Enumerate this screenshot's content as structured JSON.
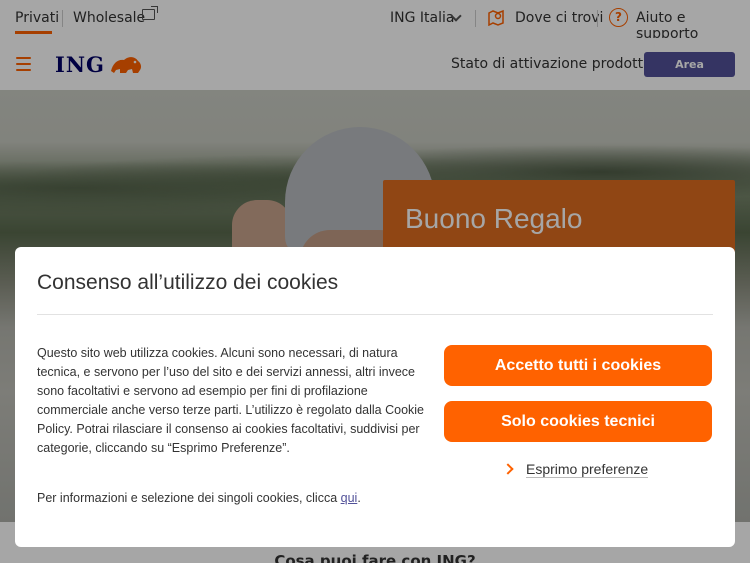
{
  "topbar": {
    "privati": "Privati",
    "wholesale": "Wholesale",
    "ing_italia": "ING Italia",
    "dove_ci_trovi": "Dove ci trovi",
    "help_glyph": "?",
    "aiuto": "Aiuto e supporto"
  },
  "header": {
    "logo": "ING",
    "stato": "Stato di attivazione prodotti",
    "area_riservata": "Area Riservata"
  },
  "hero": {
    "promo_title": "Buono Regalo"
  },
  "below": {
    "text": "Cosa puoi fare con ING?"
  },
  "cookie_modal": {
    "title": "Consenso all’utilizzo dei cookies",
    "body": "Questo sito web utilizza cookies. Alcuni sono necessari, di natura tecnica, e servono per l’uso del sito e dei servizi annessi, altri invece sono facoltativi e servono ad esempio per fini di profilazione commerciale anche verso terze parti. L’utilizzo è regolato dalla Cookie Policy. Potrai rilasciare il consenso ai cookies facoltativi, suddivisi per categorie, cliccando su “Esprimo Preferenze”.",
    "info_prefix": "Per informazioni e selezione dei singoli cookies, clicca ",
    "info_link": "qui",
    "info_suffix": ".",
    "accept_all": "Accetto tutti i cookies",
    "only_technical": "Solo cookies tecnici",
    "preferences": "Esprimo preferenze"
  },
  "colors": {
    "accent": "#ff6200",
    "brand_blue": "#000066",
    "area_button": "#525199",
    "promo_card": "#dd6c20"
  }
}
